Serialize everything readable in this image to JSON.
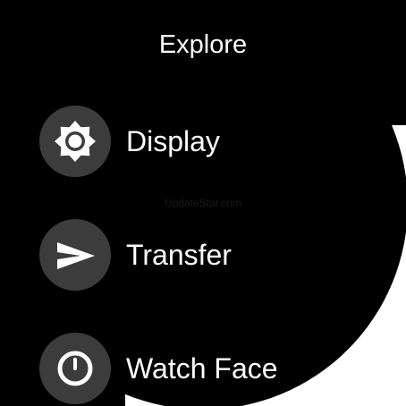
{
  "header": {
    "title": "Explore"
  },
  "menu": {
    "items": [
      {
        "label": "Display",
        "icon": "brightness-icon"
      },
      {
        "label": "Transfer",
        "icon": "send-icon"
      },
      {
        "label": "Watch Face",
        "icon": "watch-face-icon"
      }
    ]
  },
  "watermark": {
    "text": "UpdateStar.com"
  },
  "colors": {
    "background": "#000000",
    "icon_circle": "#3c3c3c",
    "text": "#ffffff"
  }
}
